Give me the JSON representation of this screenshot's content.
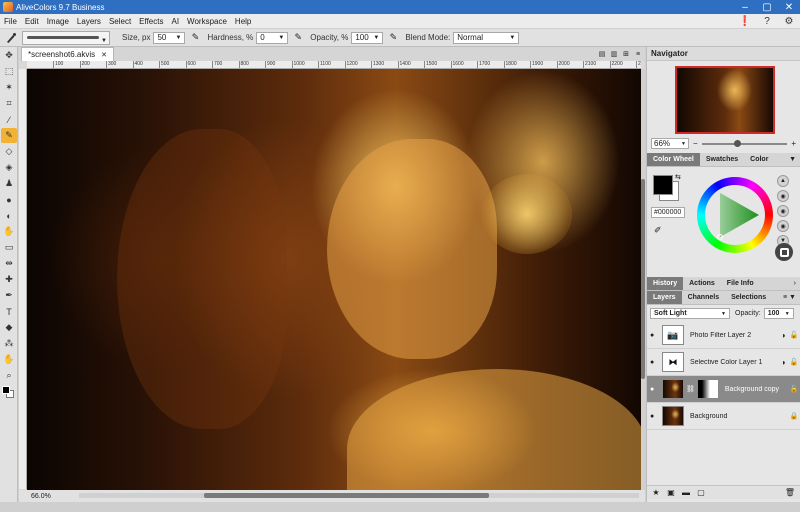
{
  "window": {
    "title": "AliveColors 9.7 Business"
  },
  "menu": [
    "File",
    "Edit",
    "Image",
    "Layers",
    "Select",
    "Effects",
    "AI",
    "Workspace",
    "Help"
  ],
  "options": {
    "size_label": "Size, px",
    "size_value": "50",
    "hardness_label": "Hardness, %",
    "hardness_value": "0",
    "opacity_label": "Opacity, %",
    "opacity_value": "100",
    "blend_label": "Blend Mode:",
    "blend_value": "Normal"
  },
  "document": {
    "tab_name": "*screenshot6.akvis",
    "zoom": "66.0%",
    "ruler_ticks": [
      "100",
      "200",
      "300",
      "400",
      "500",
      "600",
      "700",
      "800",
      "900",
      "1000",
      "1100",
      "1200",
      "1300",
      "1400",
      "1500",
      "1600",
      "1700",
      "1800",
      "1900",
      "2000",
      "2100",
      "2200",
      "2300"
    ]
  },
  "navigator": {
    "title": "Navigator",
    "zoom": "66%"
  },
  "color_tabs": [
    "Color Wheel",
    "Swatches",
    "Color"
  ],
  "color": {
    "hex": "#000000",
    "fg": "#000000",
    "bg": "#ffffff"
  },
  "history_tabs": [
    "History",
    "Actions",
    "File Info"
  ],
  "layers_tabs": [
    "Layers",
    "Channels",
    "Selections"
  ],
  "layers_blend": "Soft Light",
  "layers_opacity_label": "Opacity:",
  "layers_opacity": "100",
  "layers": [
    {
      "name": "Photo Filter Layer 2",
      "type": "camera"
    },
    {
      "name": "Selective Color Layer 1",
      "type": "selective"
    },
    {
      "name": "Background copy",
      "type": "image-mask",
      "selected": true
    },
    {
      "name": "Background",
      "type": "image"
    }
  ],
  "icons": {
    "brush": "brush-icon",
    "warning": "warning-icon",
    "help": "help-icon",
    "settings": "gear-icon"
  }
}
